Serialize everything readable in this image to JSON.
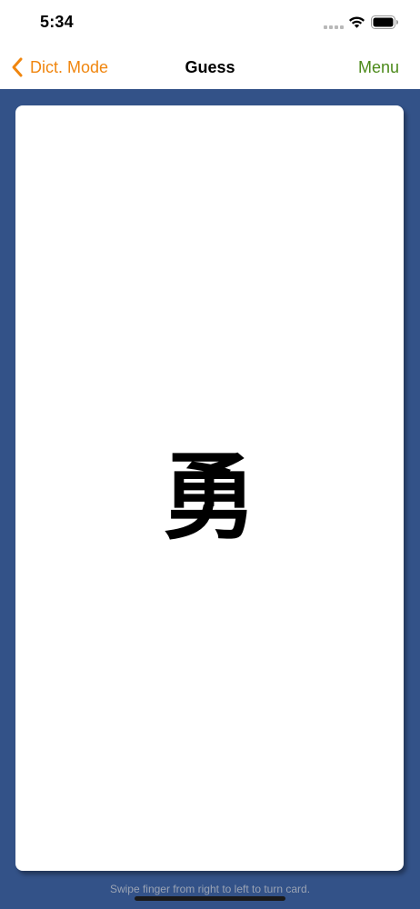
{
  "status_bar": {
    "time": "5:34"
  },
  "nav": {
    "back_label": "Dict. Mode",
    "title": "Guess",
    "menu_label": "Menu"
  },
  "card": {
    "character": "勇"
  },
  "hint": "Swipe finger from right to left to turn card.",
  "colors": {
    "back_accent": "#f0860f",
    "menu_accent": "#4c8a1a",
    "background": "#335288"
  },
  "icons": {
    "back": "chevron-left-icon",
    "wifi": "wifi-icon",
    "battery": "battery-icon",
    "signal": "signal-icon"
  }
}
